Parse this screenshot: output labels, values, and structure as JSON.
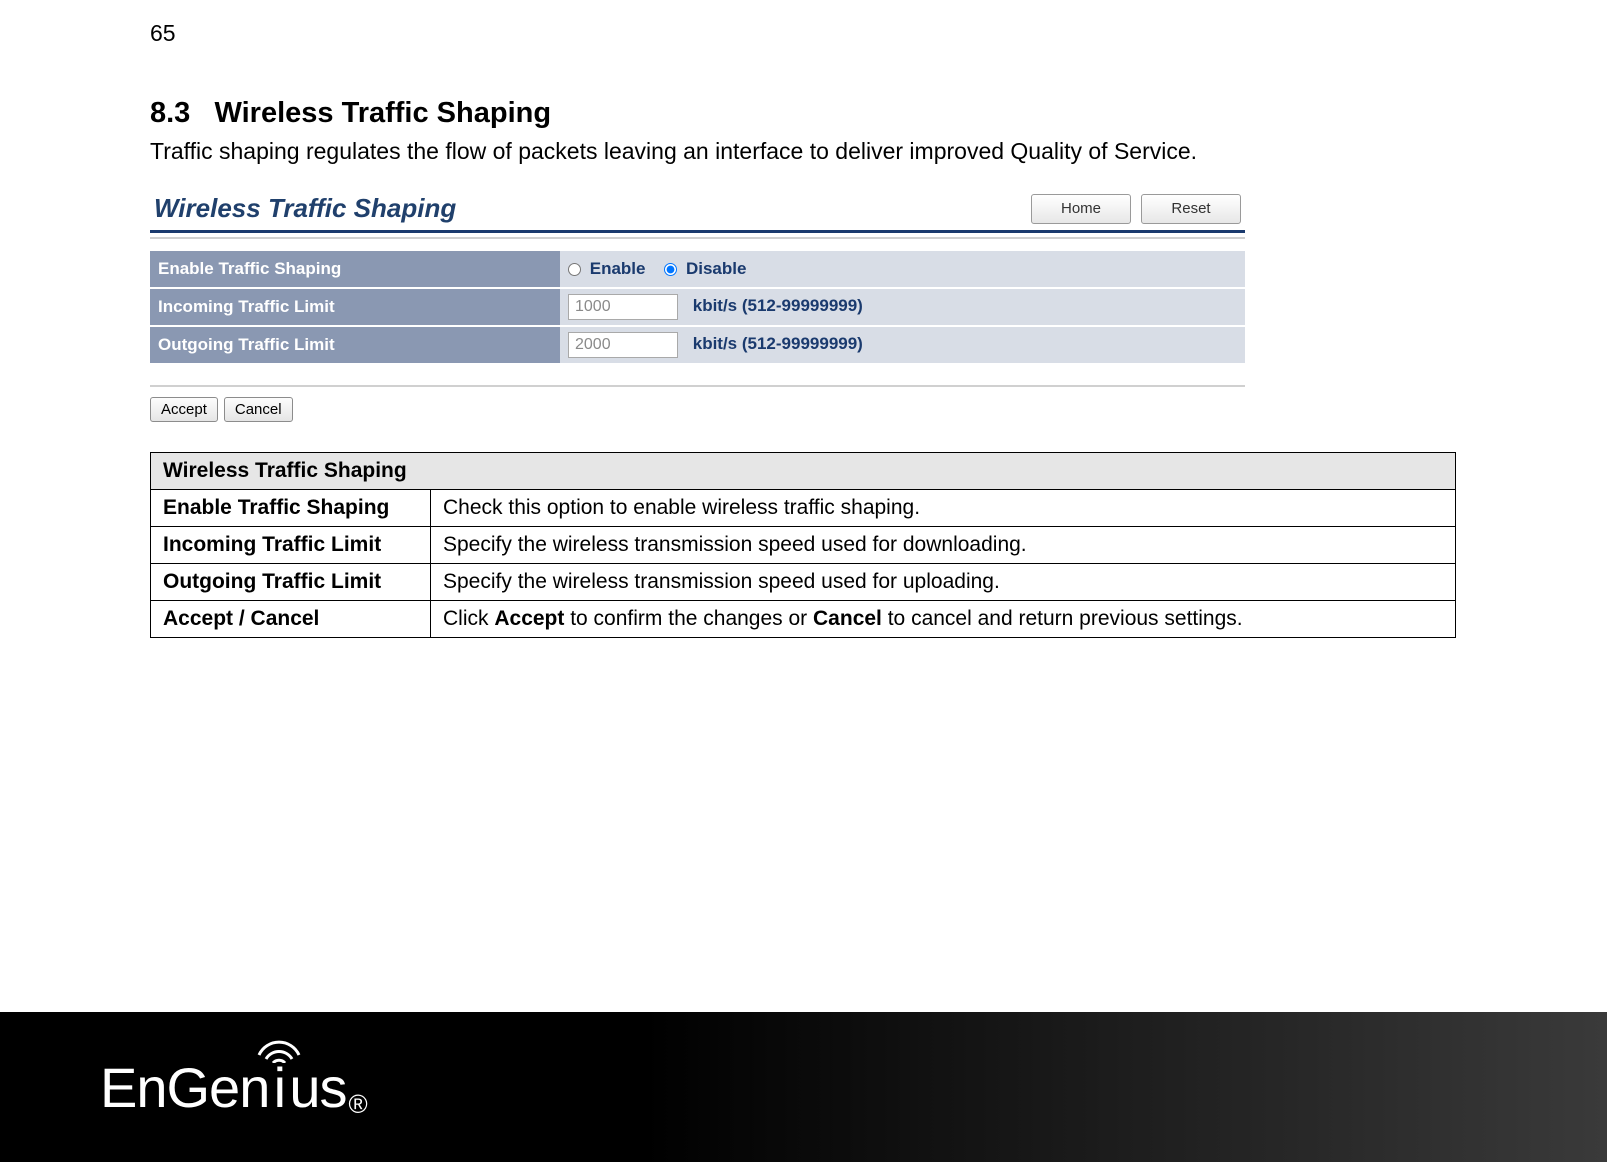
{
  "page_number": "65",
  "section_number": "8.3",
  "section_title": "Wireless Traffic Shaping",
  "section_intro": "Traffic shaping regulates the flow of packets leaving an interface to deliver improved Quality of Service.",
  "panel": {
    "title": "Wireless Traffic Shaping",
    "nav_home": "Home",
    "nav_reset": "Reset",
    "rows": {
      "enable_label": "Enable Traffic Shaping",
      "enable_option_on": "Enable",
      "enable_option_off": "Disable",
      "enable_selected": "Disable",
      "incoming_label": "Incoming Traffic Limit",
      "incoming_value": "1000",
      "incoming_unit": "kbit/s (512-99999999)",
      "outgoing_label": "Outgoing Traffic Limit",
      "outgoing_value": "2000",
      "outgoing_unit": "kbit/s (512-99999999)"
    },
    "accept": "Accept",
    "cancel": "Cancel"
  },
  "desc_table": {
    "header": "Wireless Traffic Shaping",
    "rows": [
      {
        "label": "Enable Traffic Shaping",
        "value": "Check this option to enable wireless traffic shaping."
      },
      {
        "label": "Incoming Traffic Limit",
        "value": "Specify the wireless transmission speed used for downloading."
      },
      {
        "label": "Outgoing Traffic Limit",
        "value": "Specify the wireless transmission speed used for uploading."
      },
      {
        "label": "Accept / Cancel",
        "value_html": "Click <b>Accept</b> to confirm the changes or <b>Cancel</b> to cancel and return previous settings."
      }
    ]
  },
  "footer": {
    "logo_part1": "EnGen",
    "logo_i": "i",
    "logo_part2": "us",
    "logo_reg": "®"
  }
}
